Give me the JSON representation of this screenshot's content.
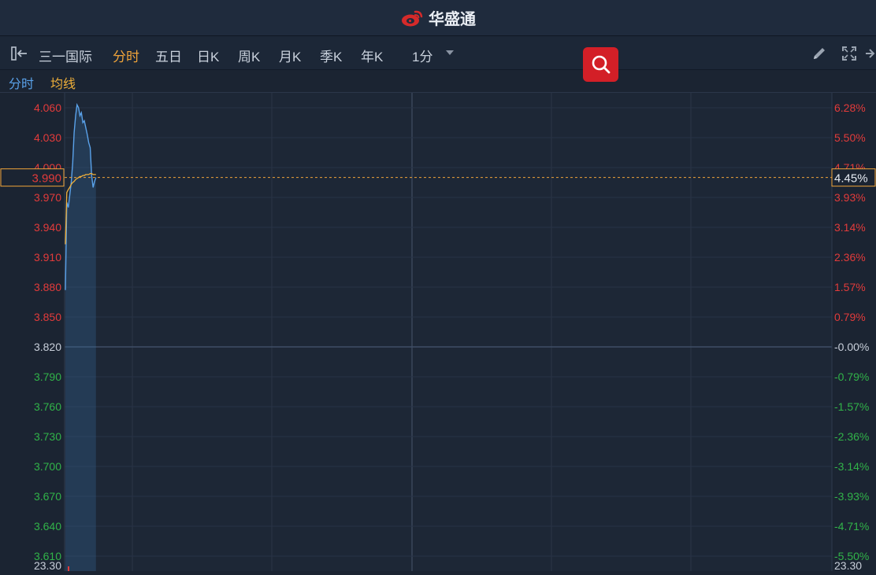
{
  "app": {
    "brand": "华盛通"
  },
  "toolbar": {
    "stock_name": "三一国际",
    "tabs": [
      "分时",
      "五日",
      "日K",
      "周K",
      "月K",
      "季K",
      "年K"
    ],
    "active_tab": "分时",
    "interval": "1分"
  },
  "legend": {
    "primary": "分时",
    "average": "均线"
  },
  "price_axis_labels": [
    {
      "price": "4.060",
      "pct": "6.28%"
    },
    {
      "price": "4.030",
      "pct": "5.50%"
    },
    {
      "price": "4.000",
      "pct": "4.71%"
    },
    {
      "price": "3.970",
      "pct": "3.93%"
    },
    {
      "price": "3.940",
      "pct": "3.14%"
    },
    {
      "price": "3.910",
      "pct": "2.36%"
    },
    {
      "price": "3.880",
      "pct": "1.57%"
    },
    {
      "price": "3.850",
      "pct": "0.79%"
    },
    {
      "price": "3.820",
      "pct": "-0.00%"
    },
    {
      "price": "3.790",
      "pct": "-0.79%"
    },
    {
      "price": "3.760",
      "pct": "-1.57%"
    },
    {
      "price": "3.730",
      "pct": "-2.36%"
    },
    {
      "price": "3.700",
      "pct": "-3.14%"
    },
    {
      "price": "3.670",
      "pct": "-3.93%"
    },
    {
      "price": "3.640",
      "pct": "-4.71%"
    },
    {
      "price": "3.610",
      "pct": "-5.50%"
    }
  ],
  "current": {
    "price": "3.990",
    "pct": "4.45%"
  },
  "volume_axis": {
    "left": "23.30",
    "right": "23.30"
  },
  "colors": {
    "up": "#e23b3b",
    "down": "#31b349",
    "neutral": "#c8cfda",
    "price_line": "#5aa2ea",
    "avg_line": "#f0b03a",
    "accent": "#f0a43a"
  },
  "chart_data": {
    "type": "line",
    "series": [
      {
        "name": "分时",
        "x": [
          0,
          1,
          2,
          3,
          4,
          5,
          6,
          7,
          8,
          9,
          10,
          11,
          12,
          13,
          14,
          15,
          16,
          17,
          18,
          19,
          20,
          21
        ],
        "values": [
          3.877,
          3.965,
          3.96,
          3.972,
          3.985,
          4.005,
          4.035,
          4.052,
          4.063,
          4.06,
          4.052,
          4.055,
          4.045,
          4.047,
          4.04,
          4.033,
          4.025,
          4.02,
          3.992,
          3.98,
          3.986,
          3.99
        ]
      },
      {
        "name": "均线",
        "x": [
          0,
          1,
          2,
          3,
          4,
          5,
          6,
          7,
          8,
          9,
          10,
          11,
          12,
          13,
          14,
          15,
          16,
          17,
          18,
          19,
          20,
          21
        ],
        "values": [
          3.923,
          3.975,
          3.978,
          3.98,
          3.983,
          3.985,
          3.986,
          3.988,
          3.989,
          3.99,
          3.991,
          3.991,
          3.992,
          3.992,
          3.993,
          3.993,
          3.993,
          3.994,
          3.994,
          3.993,
          3.993,
          3.993
        ]
      }
    ],
    "prev_close": 3.82,
    "ylim": [
      3.595,
      4.075
    ]
  }
}
